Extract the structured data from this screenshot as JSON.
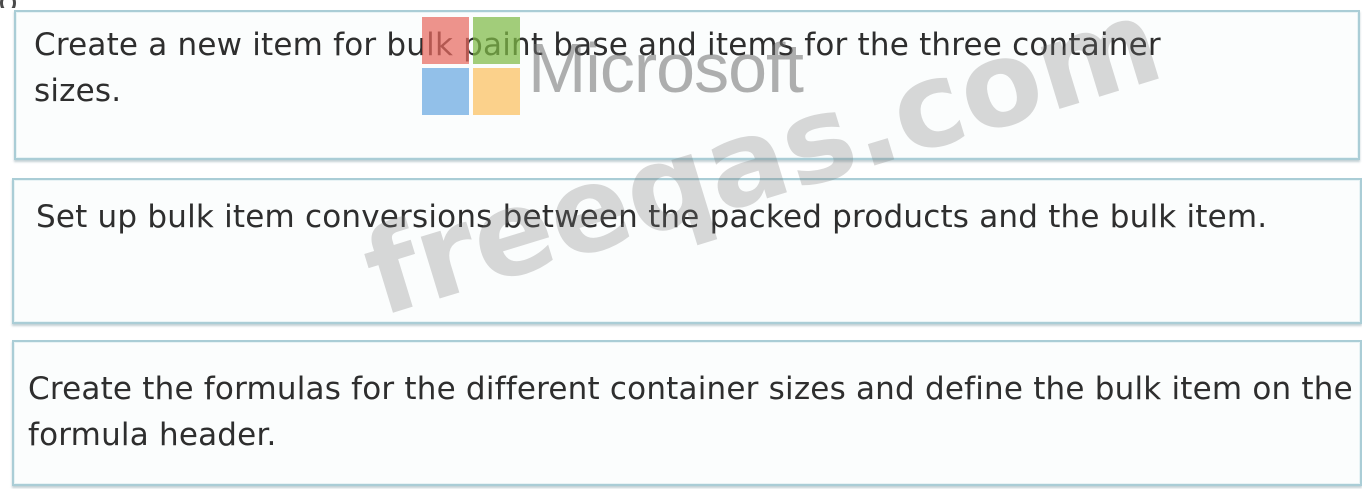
{
  "steps": [
    {
      "text": "Create a new item for bulk paint base and items for the three container sizes."
    },
    {
      "text": "Set up bulk item conversions between the packed products and the bulk item."
    },
    {
      "text": "Create the formulas for the different container sizes and define the bulk item on the formula header."
    }
  ],
  "overlay": {
    "logo_text": "Microsoft",
    "watermark_text": "freeqas.com",
    "logo_colors": [
      "#e86a5f",
      "#7fba47",
      "#6aa8e0",
      "#fbbf5e"
    ]
  }
}
